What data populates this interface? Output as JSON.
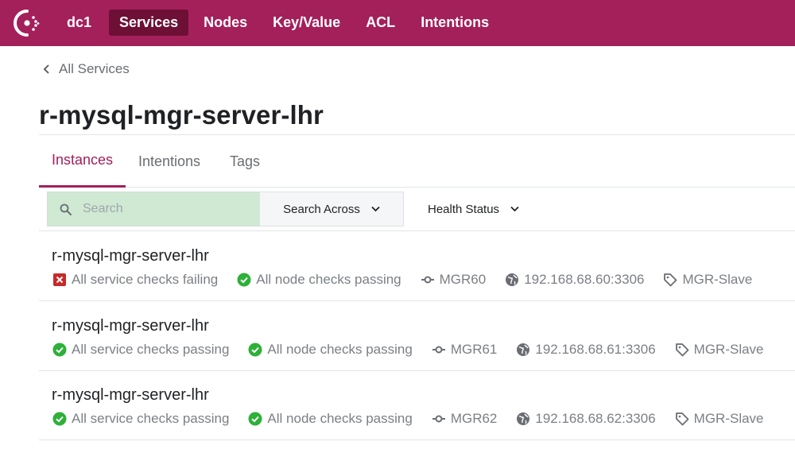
{
  "nav": {
    "dc": "dc1",
    "items": [
      {
        "label": "Services",
        "active": true
      },
      {
        "label": "Nodes",
        "active": false
      },
      {
        "label": "Key/Value",
        "active": false
      },
      {
        "label": "ACL",
        "active": false
      },
      {
        "label": "Intentions",
        "active": false
      }
    ]
  },
  "breadcrumb": {
    "label": "All Services"
  },
  "page": {
    "title": "r-mysql-mgr-server-lhr"
  },
  "tabs": [
    {
      "label": "Instances",
      "active": true
    },
    {
      "label": "Intentions",
      "active": false
    },
    {
      "label": "Tags",
      "active": false
    }
  ],
  "filters": {
    "search_placeholder": "Search",
    "search_across": "Search Across",
    "health_status": "Health Status"
  },
  "instances": [
    {
      "name": "r-mysql-mgr-server-lhr",
      "service_checks": "All service checks failing",
      "service_status": "failing",
      "node_checks": "All node checks passing",
      "node": "MGR60",
      "address": "192.168.68.60:3306",
      "tag": "MGR-Slave"
    },
    {
      "name": "r-mysql-mgr-server-lhr",
      "service_checks": "All service checks passing",
      "service_status": "passing",
      "node_checks": "All node checks passing",
      "node": "MGR61",
      "address": "192.168.68.61:3306",
      "tag": "MGR-Slave"
    },
    {
      "name": "r-mysql-mgr-server-lhr",
      "service_checks": "All service checks passing",
      "service_status": "passing",
      "node_checks": "All node checks passing",
      "node": "MGR62",
      "address": "192.168.68.62:3306",
      "tag": "MGR-Slave"
    }
  ],
  "colors": {
    "brand": "#a3205b",
    "brand_dark": "#6e0f35",
    "passing": "#2eb039",
    "failing": "#c62a2a",
    "search_bg": "#cfe9d3"
  },
  "icons": {
    "logo": "consul-logo-icon",
    "back": "chevron-left-icon",
    "search": "search-icon",
    "dropdown": "chevron-down-icon",
    "pass": "check-circle-icon",
    "fail": "x-square-icon",
    "node": "node-icon",
    "address": "globe-icon",
    "tag": "tag-icon"
  }
}
